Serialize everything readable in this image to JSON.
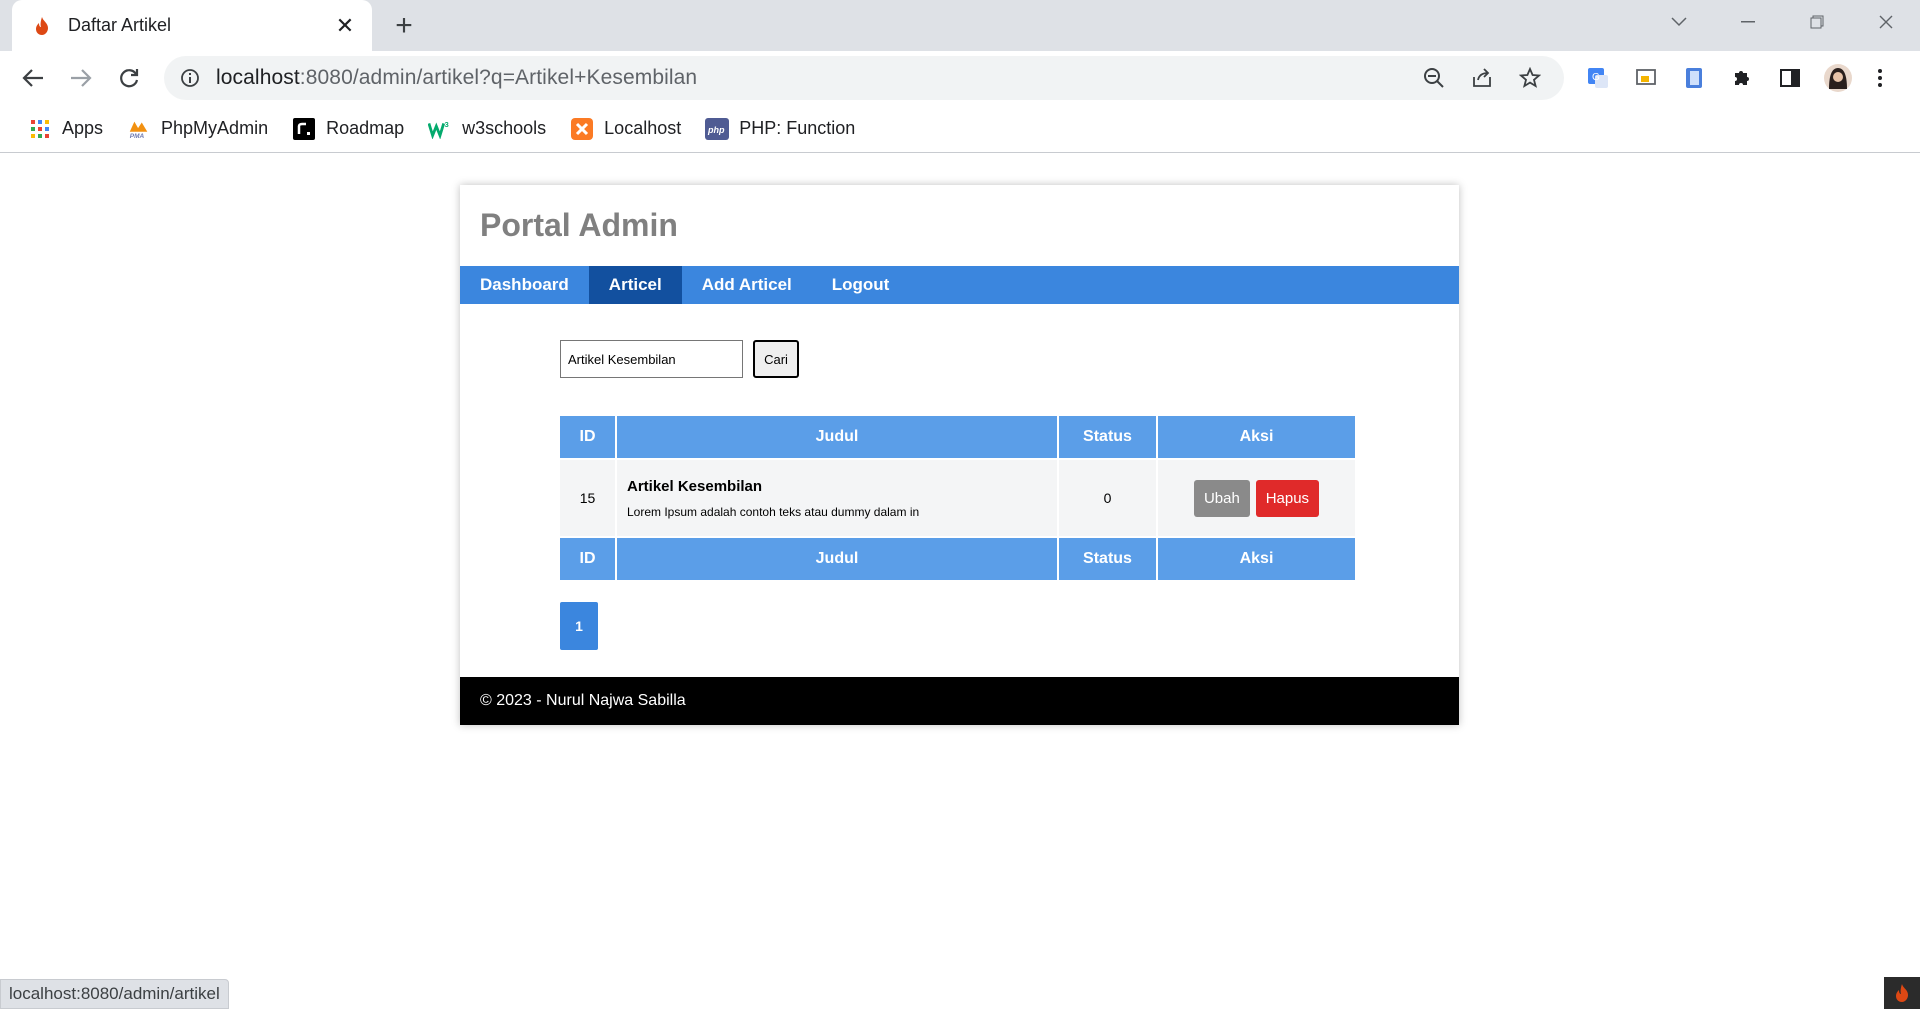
{
  "browser": {
    "tab_title": "Daftar Artikel",
    "url_host": "localhost",
    "url_rest": ":8080/admin/artikel?q=Artikel+Kesembilan",
    "bookmarks": [
      {
        "label": "Apps",
        "icon": "apps-grid-icon"
      },
      {
        "label": "PhpMyAdmin",
        "icon": "phpmyadmin-icon"
      },
      {
        "label": "Roadmap",
        "icon": "roadmap-icon"
      },
      {
        "label": "w3schools",
        "icon": "w3schools-icon"
      },
      {
        "label": "Localhost",
        "icon": "xampp-icon"
      },
      {
        "label": "PHP: Function",
        "icon": "php-icon"
      }
    ],
    "status_url": "localhost:8080/admin/artikel"
  },
  "page": {
    "header_title": "Portal Admin",
    "nav": [
      {
        "label": "Dashboard",
        "active": false
      },
      {
        "label": "Articel",
        "active": true
      },
      {
        "label": "Add Articel",
        "active": false
      },
      {
        "label": "Logout",
        "active": false
      }
    ],
    "search": {
      "value": "Artikel Kesembilan",
      "button": "Cari"
    },
    "table": {
      "headers": [
        "ID",
        "Judul",
        "Status",
        "Aksi"
      ],
      "rows": [
        {
          "id": "15",
          "title": "Artikel Kesembilan",
          "snippet": "Lorem Ipsum adalah contoh teks atau dummy dalam in",
          "status": "0",
          "edit_label": "Ubah",
          "delete_label": "Hapus"
        }
      ]
    },
    "pagination": [
      "1"
    ],
    "footer": "© 2023 - Nurul Najwa Sabilla"
  },
  "colors": {
    "nav_bg": "#3b86de",
    "nav_active": "#12509f",
    "table_header": "#5b9ee8",
    "delete_button": "#e02a2a",
    "edit_button": "#8a8a8a"
  }
}
